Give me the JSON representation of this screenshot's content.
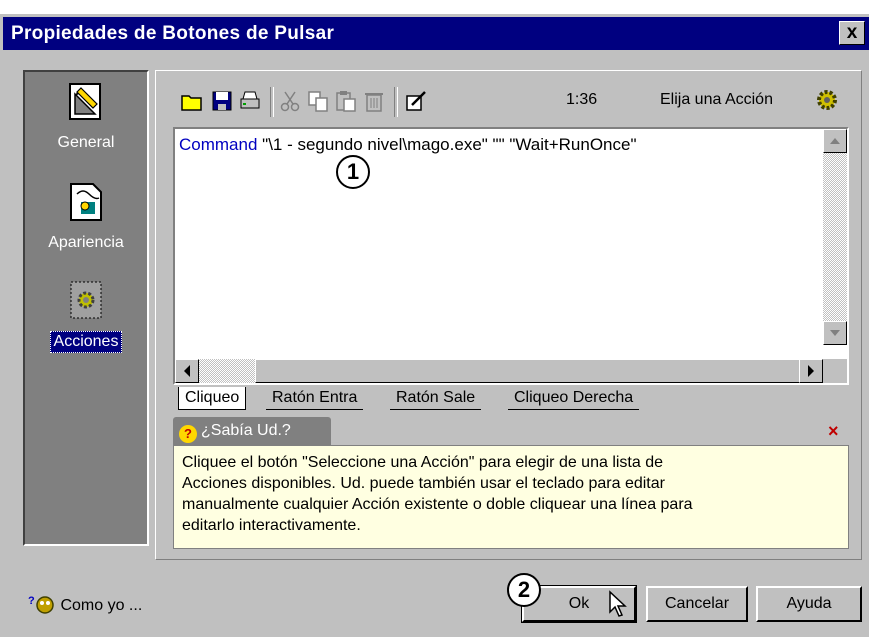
{
  "window": {
    "title": "Propiedades de Botones de Pulsar",
    "close_label": "x"
  },
  "sidebar": {
    "items": [
      {
        "label": "General",
        "icon": "pencil-ruler-icon",
        "active": false
      },
      {
        "label": "Apariencia",
        "icon": "page-paint-icon",
        "active": false
      },
      {
        "label": "Acciones",
        "icon": "gear-page-icon",
        "active": true
      }
    ]
  },
  "toolbar": {
    "buttons": [
      "open-folder-icon",
      "save-disk-icon",
      "print-icon",
      "cut-icon",
      "copy-icon",
      "paste-icon",
      "delete-icon",
      "edit-icon"
    ],
    "time": "1:36",
    "select_action_label": "Elija una Acción"
  },
  "editor": {
    "command_keyword": "Command",
    "command_args": "\"\\1 - segundo nivel\\mago.exe\" \"\" \"Wait+RunOnce\""
  },
  "tabs": [
    "Cliqueo",
    "Ratón Entra",
    "Ratón Sale",
    "Cliqueo Derecha"
  ],
  "tip": {
    "title": "¿Sabía Ud.?",
    "close": "×",
    "lines": [
      "Cliquee el botón \"Seleccione una Acción\" para elegir de una lista de",
      "Acciones disponibles. Ud. puede también usar el teclado para editar",
      "manualmente cualquier Acción existente o doble cliquear una línea para",
      "editarlo interactivamente."
    ]
  },
  "footer": {
    "help_me_label": "Como yo ...",
    "ok_label": "Ok",
    "cancel_label": "Cancelar",
    "help_label": "Ayuda"
  },
  "callouts": {
    "first": "1",
    "second": "2"
  },
  "colors": {
    "titlebar": "#000080",
    "keyword": "#0000c0",
    "tip_bg": "#ffffe1",
    "close_x": "#c00000"
  }
}
